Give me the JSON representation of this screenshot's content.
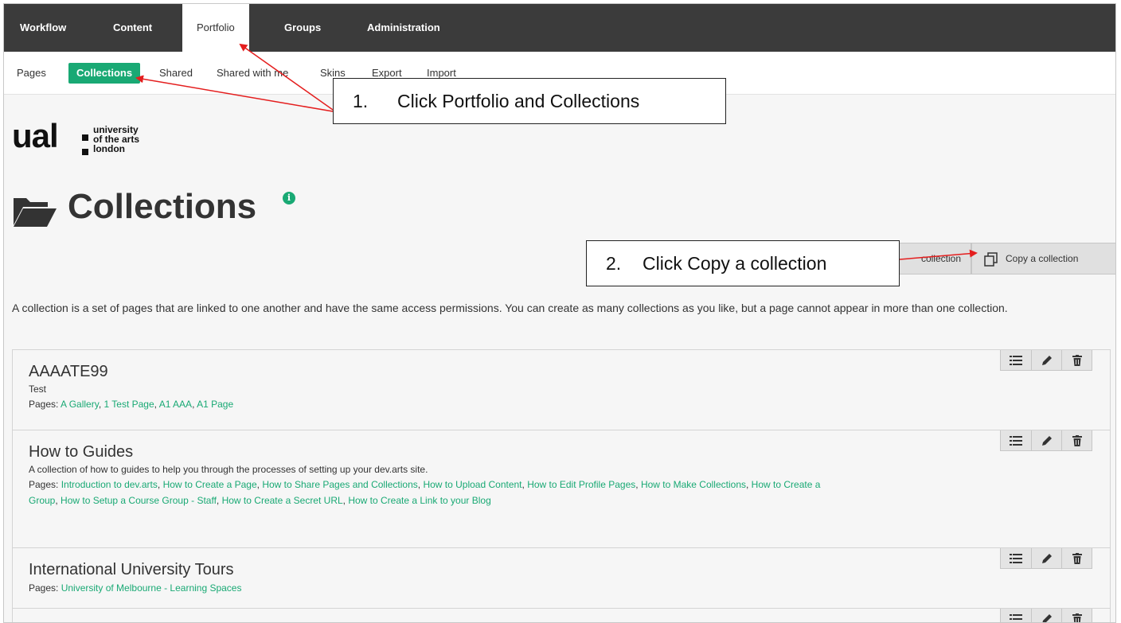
{
  "top_nav": [
    "Workflow",
    "Content",
    "Portfolio",
    "Groups",
    "Administration"
  ],
  "sub_nav": [
    "Pages",
    "Collections",
    "Shared",
    "Shared with me",
    "Skins",
    "Export",
    "Import"
  ],
  "logo": {
    "mark": "ual",
    "line1": "university",
    "line2": "of the arts",
    "line3": "london"
  },
  "page_title": "Collections",
  "info_icon_glyph": "i",
  "buttons": {
    "new_collection": "collection",
    "copy_collection": "Copy a collection"
  },
  "description": "A collection is a set of pages that are linked to one another and have the same access permissions. You can create as many collections as you like, but a page cannot appear in more than one collection.",
  "pages_label": "Pages:",
  "collections": [
    {
      "name": "AAAATE99",
      "description": "Test",
      "pages": [
        "A Gallery",
        "1 Test Page",
        "A1 AAA",
        "A1 Page"
      ]
    },
    {
      "name": "How to Guides",
      "description": "A collection of how to guides to help you through the processes of setting up your dev.arts site.",
      "pages": [
        "Introduction to dev.arts",
        "How to Create a Page",
        "How to Share Pages and Collections",
        "How to Upload Content",
        "How to Edit Profile Pages",
        "How to Make Collections",
        "How to Create a Group",
        "How to Setup a Course Group - Staff",
        "How to Create a Secret URL",
        "How to Create a Link to your Blog"
      ]
    },
    {
      "name": "International University Tours",
      "description": "",
      "pages": [
        "University of Melbourne - Learning Spaces"
      ]
    }
  ],
  "callouts": [
    {
      "num": "1.",
      "text": "Click Portfolio and Collections"
    },
    {
      "num": "2.",
      "text": "Click Copy a collection"
    }
  ],
  "colors": {
    "nav_bg": "#3b3b3b",
    "accent": "#19a974",
    "annotation_arrow": "#e41e1e"
  }
}
